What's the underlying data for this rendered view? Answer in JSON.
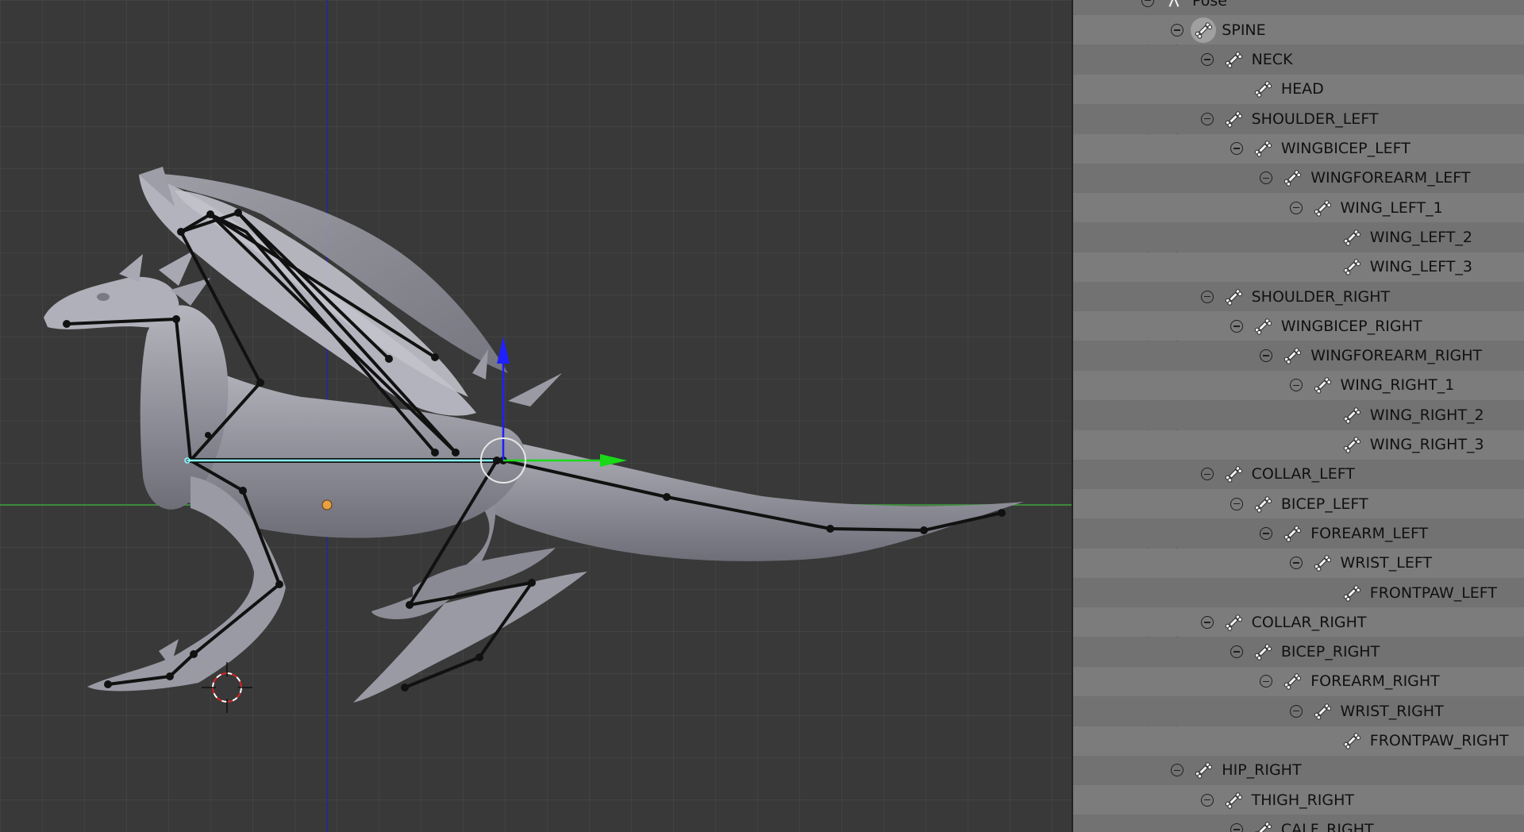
{
  "outliner": {
    "rows": [
      {
        "label": "Pose",
        "indent": 0,
        "toggle": true,
        "icon": "pose-icon"
      },
      {
        "label": "SPINE",
        "indent": 1,
        "toggle": true,
        "icon": "bone-icon",
        "active": true
      },
      {
        "label": "NECK",
        "indent": 2,
        "toggle": true,
        "icon": "bone-icon"
      },
      {
        "label": "HEAD",
        "indent": 3,
        "toggle": false,
        "icon": "bone-icon"
      },
      {
        "label": "SHOULDER_LEFT",
        "indent": 2,
        "toggle": true,
        "icon": "bone-icon"
      },
      {
        "label": "WINGBICEP_LEFT",
        "indent": 3,
        "toggle": true,
        "icon": "bone-icon"
      },
      {
        "label": "WINGFOREARM_LEFT",
        "indent": 4,
        "toggle": true,
        "icon": "bone-icon"
      },
      {
        "label": "WING_LEFT_1",
        "indent": 5,
        "toggle": true,
        "icon": "bone-icon"
      },
      {
        "label": "WING_LEFT_2",
        "indent": 6,
        "toggle": false,
        "icon": "bone-icon"
      },
      {
        "label": "WING_LEFT_3",
        "indent": 6,
        "toggle": false,
        "icon": "bone-icon"
      },
      {
        "label": "SHOULDER_RIGHT",
        "indent": 2,
        "toggle": true,
        "icon": "bone-icon"
      },
      {
        "label": "WINGBICEP_RIGHT",
        "indent": 3,
        "toggle": true,
        "icon": "bone-icon"
      },
      {
        "label": "WINGFOREARM_RIGHT",
        "indent": 4,
        "toggle": true,
        "icon": "bone-icon"
      },
      {
        "label": "WING_RIGHT_1",
        "indent": 5,
        "toggle": true,
        "icon": "bone-icon"
      },
      {
        "label": "WING_RIGHT_2",
        "indent": 6,
        "toggle": false,
        "icon": "bone-icon"
      },
      {
        "label": "WING_RIGHT_3",
        "indent": 6,
        "toggle": false,
        "icon": "bone-icon"
      },
      {
        "label": "COLLAR_LEFT",
        "indent": 2,
        "toggle": true,
        "icon": "bone-icon"
      },
      {
        "label": "BICEP_LEFT",
        "indent": 3,
        "toggle": true,
        "icon": "bone-icon"
      },
      {
        "label": "FOREARM_LEFT",
        "indent": 4,
        "toggle": true,
        "icon": "bone-icon"
      },
      {
        "label": "WRIST_LEFT",
        "indent": 5,
        "toggle": true,
        "icon": "bone-icon"
      },
      {
        "label": "FRONTPAW_LEFT",
        "indent": 6,
        "toggle": false,
        "icon": "bone-icon"
      },
      {
        "label": "COLLAR_RIGHT",
        "indent": 2,
        "toggle": true,
        "icon": "bone-icon"
      },
      {
        "label": "BICEP_RIGHT",
        "indent": 3,
        "toggle": true,
        "icon": "bone-icon"
      },
      {
        "label": "FOREARM_RIGHT",
        "indent": 4,
        "toggle": true,
        "icon": "bone-icon"
      },
      {
        "label": "WRIST_RIGHT",
        "indent": 5,
        "toggle": true,
        "icon": "bone-icon"
      },
      {
        "label": "FRONTPAW_RIGHT",
        "indent": 6,
        "toggle": false,
        "icon": "bone-icon"
      },
      {
        "label": "HIP_RIGHT",
        "indent": 1,
        "toggle": true,
        "icon": "bone-icon"
      },
      {
        "label": "THIGH_RIGHT",
        "indent": 2,
        "toggle": true,
        "icon": "bone-icon"
      },
      {
        "label": "CALF_RIGHT",
        "indent": 3,
        "toggle": true,
        "icon": "bone-icon"
      }
    ]
  },
  "colors": {
    "viewport_bg": "#393939",
    "outliner_bg": "#727272",
    "x_axis": "#3f8f3f",
    "z_axis": "#3232a0",
    "gizmo_up": "#1a1aff",
    "gizmo_right": "#19d919",
    "selected_bone": "#7fffff",
    "origin": "#e8a040"
  }
}
